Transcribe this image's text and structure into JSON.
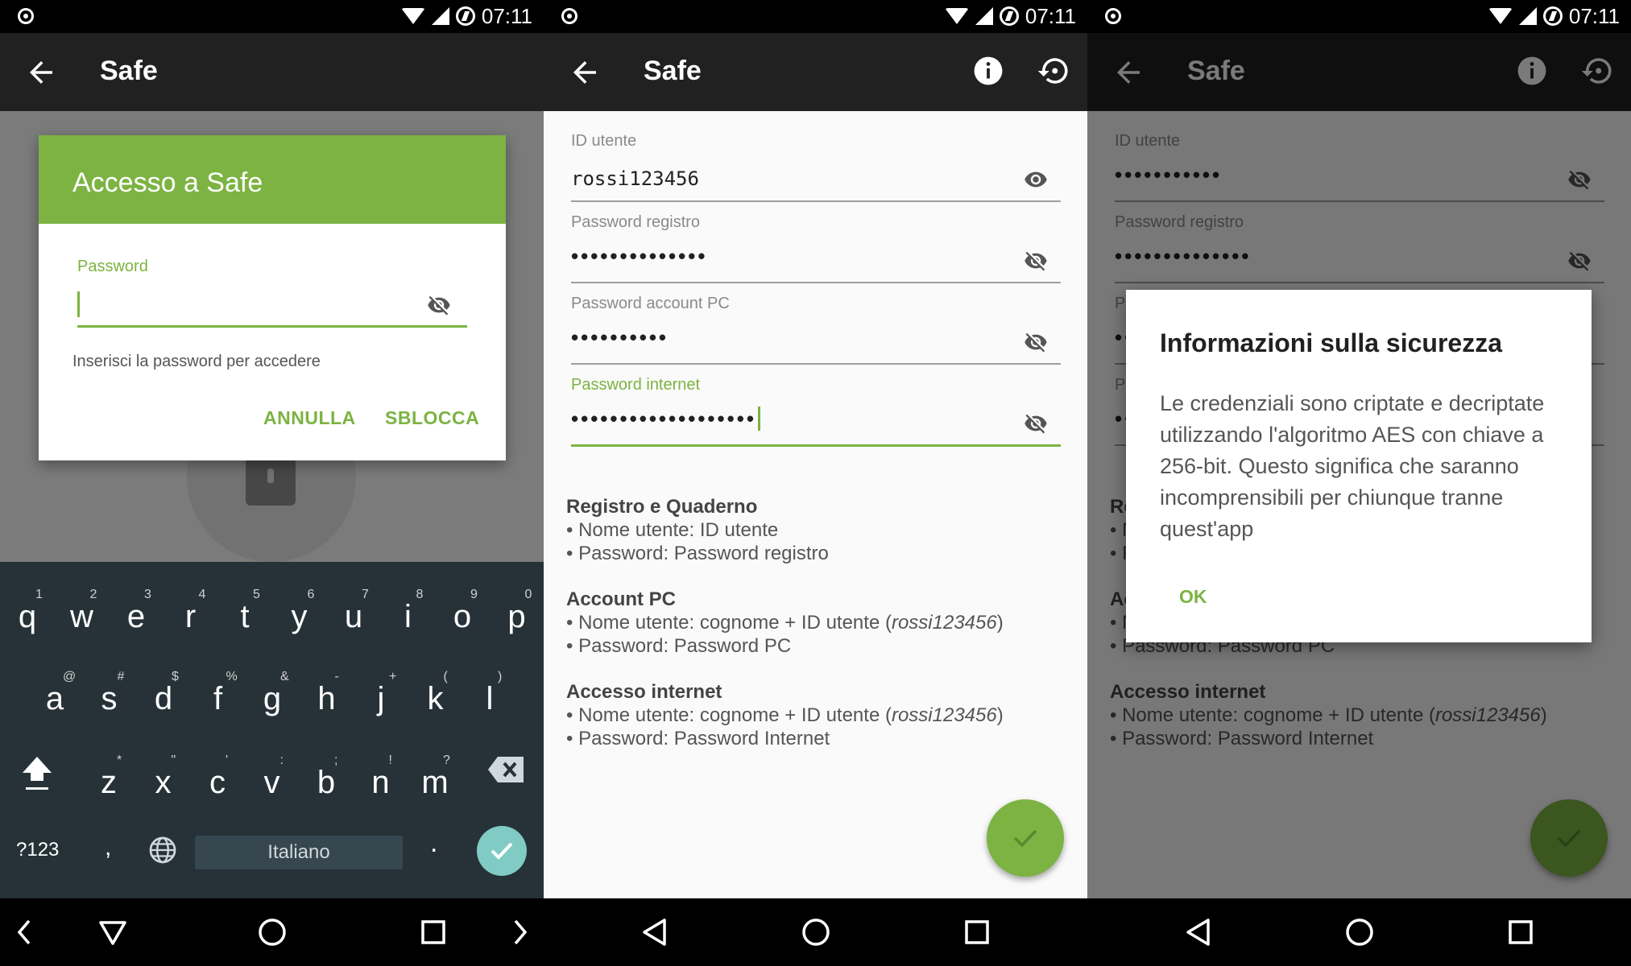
{
  "status_bar": {
    "time": "07:11"
  },
  "app_bar": {
    "title": "Safe"
  },
  "unlock_dialog": {
    "title": "Accesso a Safe",
    "password_label": "Password",
    "password_value": "",
    "hint": "Inserisci la password per accedere",
    "cancel_label": "ANNULLA",
    "unlock_label": "SBLOCCA"
  },
  "keyboard": {
    "row1": [
      {
        "k": "q",
        "h": "1"
      },
      {
        "k": "w",
        "h": "2"
      },
      {
        "k": "e",
        "h": "3"
      },
      {
        "k": "r",
        "h": "4"
      },
      {
        "k": "t",
        "h": "5"
      },
      {
        "k": "y",
        "h": "6"
      },
      {
        "k": "u",
        "h": "7"
      },
      {
        "k": "i",
        "h": "8"
      },
      {
        "k": "o",
        "h": "9"
      },
      {
        "k": "p",
        "h": "0"
      }
    ],
    "row2": [
      {
        "k": "a",
        "h": "@"
      },
      {
        "k": "s",
        "h": "#"
      },
      {
        "k": "d",
        "h": "$"
      },
      {
        "k": "f",
        "h": "%"
      },
      {
        "k": "g",
        "h": "&"
      },
      {
        "k": "h",
        "h": "-"
      },
      {
        "k": "j",
        "h": "+"
      },
      {
        "k": "k",
        "h": "("
      },
      {
        "k": "l",
        "h": ")"
      }
    ],
    "row3": [
      {
        "k": "z",
        "h": "*"
      },
      {
        "k": "x",
        "h": "\""
      },
      {
        "k": "c",
        "h": "'"
      },
      {
        "k": "v",
        "h": ":"
      },
      {
        "k": "b",
        "h": ";"
      },
      {
        "k": "n",
        "h": "!"
      },
      {
        "k": "m",
        "h": "?"
      }
    ],
    "symbols_label": "?123",
    "comma": ",",
    "period": ".",
    "language_label": "Italiano"
  },
  "form": {
    "user_id": {
      "label": "ID utente",
      "value": "rossi123456",
      "masked": "•••••••••••"
    },
    "registry_password": {
      "label": "Password registro",
      "masked": "••••••••••••••"
    },
    "pc_password": {
      "label": "Password account PC",
      "masked": "••••••••••"
    },
    "internet_password": {
      "label": "Password internet",
      "masked": "•••••••••••••••••••"
    }
  },
  "notes": {
    "registry": {
      "title": "Registro e Quaderno",
      "line1": "• Nome utente: ID utente",
      "line2": "• Password: Password registro"
    },
    "pc": {
      "title": "Account PC",
      "line1_prefix": "• Nome utente: cognome + ID utente (",
      "line1_italic": "rossi123456",
      "line1_suffix": ")",
      "line2": "• Password: Password PC"
    },
    "internet": {
      "title": "Accesso internet",
      "line1_prefix": "• Nome utente: cognome + ID utente (",
      "line1_italic": "rossi123456",
      "line1_suffix": ")",
      "line2": "• Password: Password Internet"
    }
  },
  "info_dialog": {
    "title": "Informazioni sulla sicurezza",
    "body": "Le credenziali sono criptate e decriptate utilizzando l'algoritmo AES con chiave a 256-bit. Questo significa che saranno incomprensibili per chiunque tranne quest'app",
    "ok_label": "OK"
  },
  "colors": {
    "accent": "#7cb342",
    "app_bar": "#212121",
    "keyboard": "#263238"
  }
}
